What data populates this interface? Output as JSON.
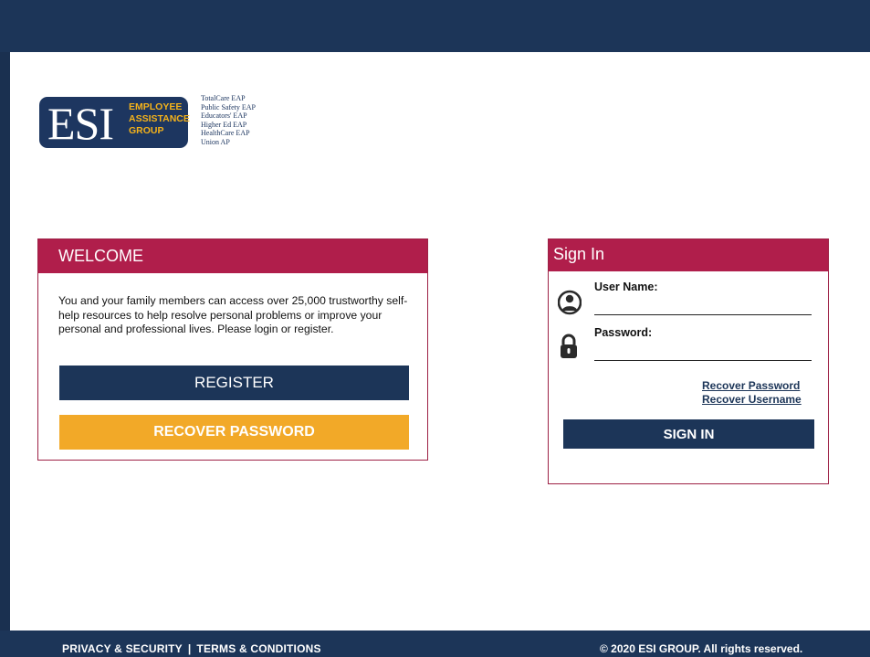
{
  "logo": {
    "name": "ESI",
    "subtitle": [
      "EMPLOYEE",
      "ASSISTANCE",
      "GROUP"
    ],
    "programs": [
      "TotalCare EAP",
      "Public Safety EAP",
      "Educators' EAP",
      "Higher Ed EAP",
      "HealthCare EAP",
      "Union AP"
    ]
  },
  "welcome": {
    "title": "WELCOME",
    "text": "You and your family members can access over 25,000 trustworthy self-help resources to help resolve personal problems or improve your personal and professional lives. Please login or register.",
    "register_label": "REGISTER",
    "recover_label": "RECOVER PASSWORD"
  },
  "signin": {
    "title": "Sign In",
    "username_label": "User Name:",
    "password_label": "Password:",
    "username_value": "",
    "password_value": "",
    "recover_password_link": "Recover Password",
    "recover_username_link": "Recover Username",
    "submit_label": "SIGN IN"
  },
  "footer": {
    "privacy_label": "PRIVACY & SECURITY",
    "separator": "|",
    "terms_label": "TERMS & CONDITIONS",
    "copyright": "© 2020 ESI GROUP. All rights reserved."
  },
  "colors": {
    "navy": "#1c3558",
    "crimson": "#b01e4b",
    "gold": "#f2a928"
  }
}
